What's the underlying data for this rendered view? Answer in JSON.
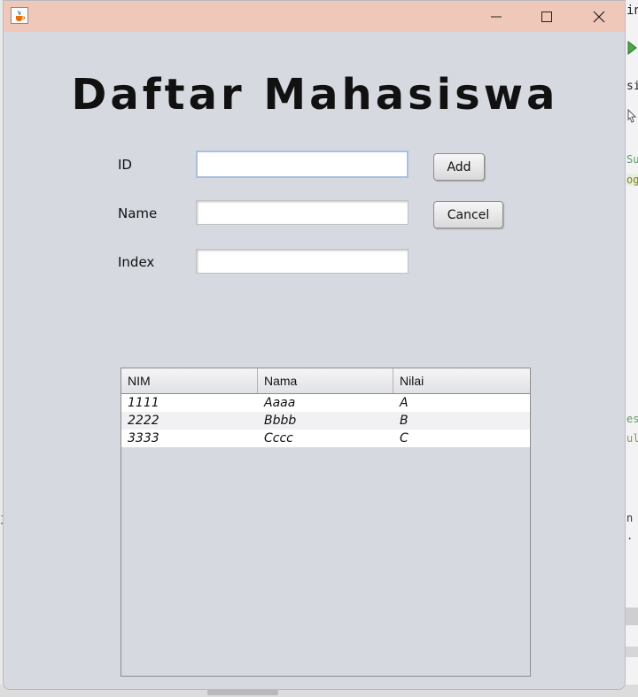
{
  "window": {
    "title": "",
    "heading": "Daftar Mahasiswa"
  },
  "form": {
    "id_label": "ID",
    "id_value": "",
    "name_label": "Name",
    "name_value": "",
    "index_label": "Index",
    "index_value": "",
    "add_label": "Add",
    "cancel_label": "Cancel"
  },
  "table": {
    "columns": [
      "NIM",
      "Nama",
      "Nilai"
    ],
    "rows": [
      [
        "1111",
        "Aaaa",
        "A"
      ],
      [
        "2222",
        "Bbbb",
        "B"
      ],
      [
        "3333",
        "Cccc",
        "C"
      ]
    ]
  },
  "background_fragments": {
    "right_top": "in",
    "right_tab": "si",
    "code_1": "Su",
    "code_2": "og",
    "code_3": "es",
    "code_4": "ul",
    "code_5": "n",
    "code_6": ".",
    "left_1": "j"
  },
  "colors": {
    "titlebar": "#efc8b9",
    "window_bg": "#d7d9e1",
    "focus_border": "#a6c1de"
  },
  "icons": {
    "app": "java-cup-icon",
    "minimize": "minimize-icon",
    "maximize": "maximize-icon",
    "close": "close-icon"
  }
}
